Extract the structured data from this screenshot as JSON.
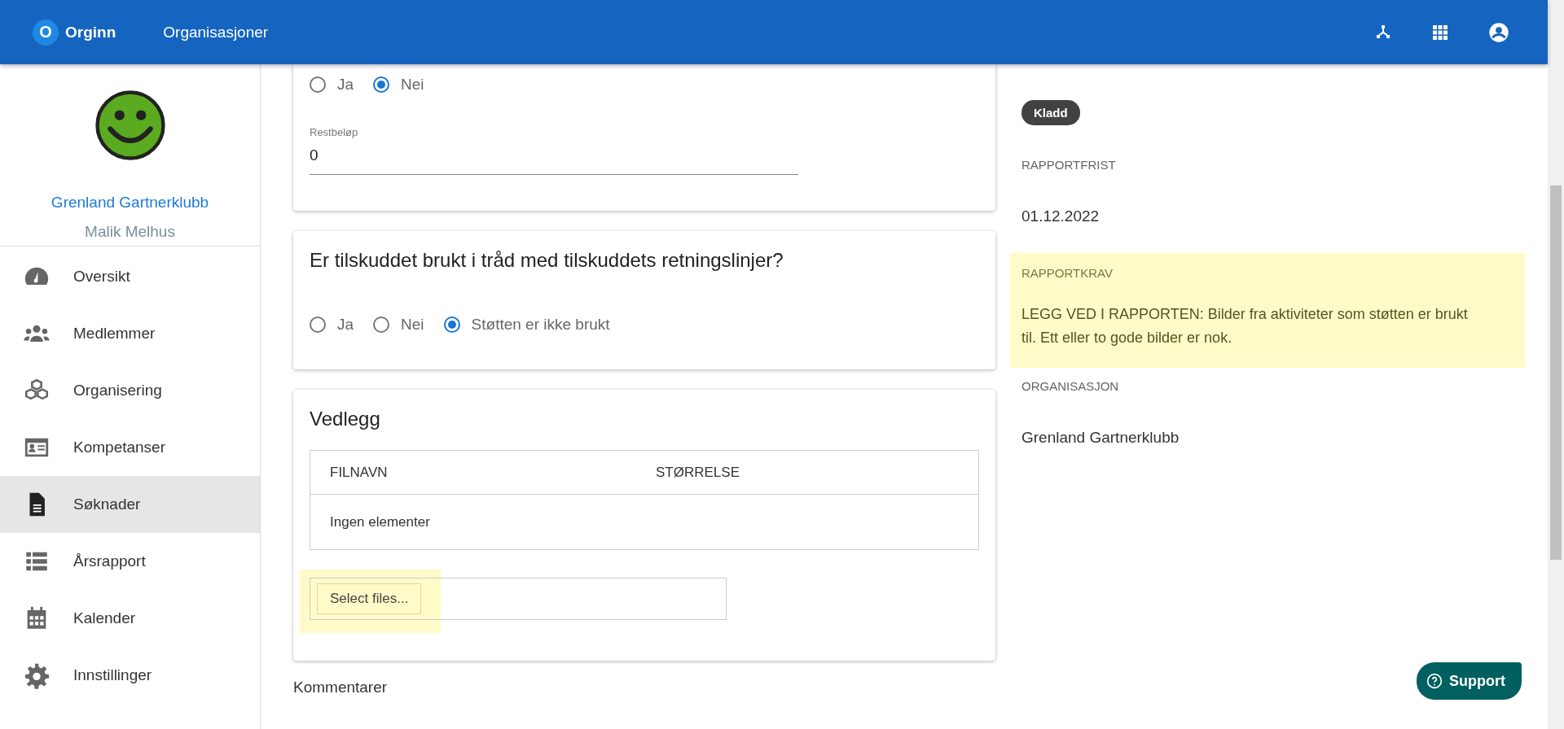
{
  "header": {
    "logo_letter": "O",
    "brand": "Orginn",
    "nav_link": "Organisasjoner"
  },
  "sidebar": {
    "org_name": "Grenland Gartnerklubb",
    "user_name": "Malik Melhus",
    "items": [
      {
        "label": "Oversikt",
        "kind": "gauge",
        "selected": false
      },
      {
        "label": "Medlemmer",
        "kind": "people",
        "selected": false
      },
      {
        "label": "Organisering",
        "kind": "cubes",
        "selected": false
      },
      {
        "label": "Kompetanser",
        "kind": "card",
        "selected": false
      },
      {
        "label": "Søknader",
        "kind": "document",
        "selected": true
      },
      {
        "label": "Årsrapport",
        "kind": "list",
        "selected": false
      },
      {
        "label": "Kalender",
        "kind": "calendar",
        "selected": false
      },
      {
        "label": "Innstillinger",
        "kind": "gear",
        "selected": false
      }
    ]
  },
  "remaining_card": {
    "options": [
      {
        "label": "Ja",
        "selected": false
      },
      {
        "label": "Nei",
        "selected": true
      }
    ],
    "field": {
      "label": "Restbeløp",
      "value": "0"
    }
  },
  "guidelines_card": {
    "question": "Er tilskuddet brukt i tråd med tilskuddets retningslinjer?",
    "options": [
      {
        "label": "Ja",
        "selected": false
      },
      {
        "label": "Nei",
        "selected": false
      },
      {
        "label": "Støtten er ikke brukt",
        "selected": true
      }
    ]
  },
  "attachments_card": {
    "title": "Vedlegg",
    "table": {
      "columns": [
        "FILNAVN",
        "STØRRELSE"
      ],
      "empty_text": "Ingen elementer"
    },
    "select_button": "Select files..."
  },
  "comments_heading": "Kommentarer",
  "details": [
    {
      "kind": "chip",
      "value": "Kladd"
    },
    {
      "kind": "text",
      "label": "RAPPORTFRIST",
      "value": "01.12.2022"
    },
    {
      "kind": "highlight",
      "label": "RAPPORTKRAV",
      "value": "LEGG VED I RAPPORTEN: Bilder fra aktiviteter som støtten er brukt til. Ett eller to gode bilder er nok."
    },
    {
      "kind": "text",
      "label": "ORGANISASJON",
      "value": "Grenland Gartnerklubb"
    }
  ],
  "support_button": "Support"
}
